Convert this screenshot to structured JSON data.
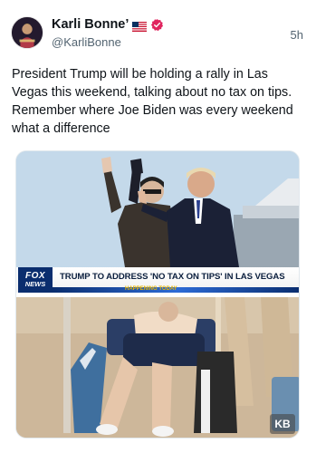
{
  "author": {
    "display_name": "Karli Bonne’",
    "handle": "@KarliBonne",
    "flag_icon": "us-flag-icon",
    "verified_icon": "verified-badge-icon",
    "verified_color": "#e0245e"
  },
  "post": {
    "timestamp": "5h",
    "text": "President Trump will be holding a rally in Las Vegas this weekend, talking about no tax on tips. Remember where Joe Biden was every weekend what a difference"
  },
  "media": {
    "top_image": {
      "network_logo_line1": "FOX",
      "network_logo_line2": "NEWS",
      "headline": "TRUMP TO ADDRESS 'NO TAX ON TIPS' IN LAS VEGAS",
      "ticker_text": "HAPPENING TODAY"
    },
    "bottom_image": {
      "watermark": "KB"
    }
  }
}
